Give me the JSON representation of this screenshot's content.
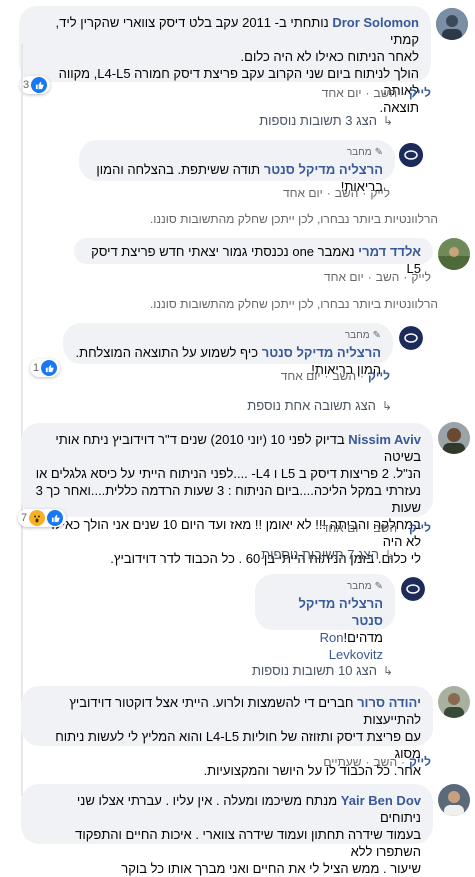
{
  "comments": {
    "dror": {
      "name": "Dror Solomon",
      "line1": "נותחתי ב- 2011 עקב בלט דיסק צווארי שהקרין ליד, קמתי",
      "line2": "לאחר הניתוח כאילו לא היה כלום.",
      "line3": "הולך לניתוח ביום שני הקרוב עקב פריצת דיסק חמורה L4-L5, מקווה לאותה",
      "line4": "תוצאה.",
      "reactions": "3",
      "like": "לייק",
      "reply": "השב",
      "time": "יום אחד"
    },
    "dror_more": "הצג 3 תשובות נוספות",
    "herzlia1": {
      "tag": "מחבר",
      "name": "הרצליה מדיקל סנטר",
      "text": "תודה ששיתפת. בהצלחה והמון בריאות!",
      "like": "לייק",
      "reply": "השב",
      "time": "יום אחד"
    },
    "notice1": "הרלוונטיות ביותר נבחרו, לכן ייתכן שחלק מהתשובות סוננו.",
    "eldad": {
      "name": "אלדד דמרי",
      "text": "נאמבר one נכנסתי גמור יצאתי חדש פריצת דיסק L5",
      "like": "לייק",
      "reply": "השב",
      "time": "יום אחד"
    },
    "notice2": "הרלוונטיות ביותר נבחרו, לכן ייתכן שחלק מהתשובות סוננו.",
    "herzlia2": {
      "tag": "מחבר",
      "name": "הרצליה מדיקל סנטר",
      "text": "כיף לשמוע על התוצאה המוצלחת. המון בריאות!",
      "reactions": "1",
      "like": "לייק",
      "reply": "השב",
      "time": "יום אחד"
    },
    "herzlia2_more": "הצג תשובה אחת נוספת",
    "nissim": {
      "name": "Nissim Aviv",
      "line1": "בדיוק לפני 10 (יוני 2010) שנים ד\"ר דוידוביץ ניתח אותי בשיטה",
      "line2": "הנ\"ל. 2 פריצות דיסק ב L5 ו L4- ....לפני הניתוח הייתי על כיסא גלגלים או",
      "line3": "נעזרתי במקל הליכה....ביום הניתוח : 3 שעות הרדמה כללית....ואחר כך 3 שעות",
      "line4": "במחלקה והביתה !!! לא יאומן !! מאז ועד היום 10 שנים אני הולך כאילו לא היה",
      "line5": "לי כלום. בזמן הניתוח הייתי בן 60 . כל הכבוד לדר דוידוביץ.",
      "reactions": "7",
      "like": "לייק",
      "reply": "השב",
      "time": "יום אחד"
    },
    "nissim_more": "הצג 7 תשובות נוספות",
    "herzlia3": {
      "tag": "מחבר",
      "name": "הרצליה מדיקל סנטר",
      "mention": "Ron Levkovitz",
      "text": "מדהים!"
    },
    "herzlia3_more": "הצג 10 תשובות נוספות",
    "yehuda": {
      "name": "יהודה סרור",
      "line1": "חברים די להשמצות ולרוע. הייתי אצל דוקטור דוידוביץ להתייעצות",
      "line2": "עם פריצת דיסק ותזוזה של חוליות L4-L5 והוא המליץ לי לעשות ניתוח מסוג",
      "line3": "אחר. כל הכבוד לו על היושר והמקצועיות.",
      "like": "לייק",
      "reply": "השב",
      "time": "שעתיים"
    },
    "yair": {
      "name": "Yair Ben Dov",
      "line1": "מנתח משיכמו ומעלה . אין עליו . עברתי אצלו שני ניתוחים",
      "line2": "בעמוד שידרה תחתון ועמוד שידרה צווארי . איכות החיים והתפקוד השתפרו ללא",
      "line3": "שיעור . ממש הציל לי את החיים ואני מברך אותו כל בוקר"
    }
  },
  "colors": {
    "link": "#385898",
    "bubble": "#f0f2f5",
    "muted": "#65676b",
    "like_blue": "#1877f2"
  }
}
